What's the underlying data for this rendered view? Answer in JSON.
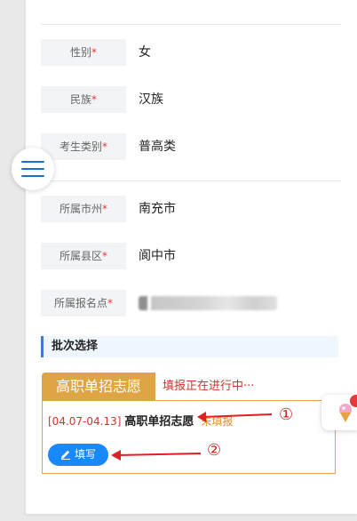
{
  "profile": {
    "fields": [
      {
        "label": "性别",
        "required_mark": "*",
        "value": "女"
      },
      {
        "label": "民族",
        "required_mark": "*",
        "value": "汉族"
      },
      {
        "label": "考生类别",
        "required_mark": "*",
        "value": "普高类"
      },
      {
        "label": "所属市州",
        "required_mark": "*",
        "value": "南充市"
      },
      {
        "label": "所属县区",
        "required_mark": "*",
        "value": "阆中市"
      },
      {
        "label": "所属报名点",
        "required_mark": "*",
        "value": ""
      }
    ]
  },
  "batch": {
    "section_title": "批次选择",
    "tab_label": "高职单招志愿",
    "status_text": "填报正在进行中···",
    "date_range": "[04.07-04.13]",
    "name": "高职单招志愿",
    "tag": "未填报",
    "fill_button_label": "填写"
  },
  "annotations": {
    "marker_1": "①",
    "marker_2": "②",
    "arrow_color": "#e02020"
  },
  "icons": {
    "menu": "hamburger-menu-icon",
    "edit": "pencil-icon",
    "widget": "ice-cream-icon"
  },
  "colors": {
    "accent": "#1989fa",
    "tab": "#dfa443",
    "status": "#d0342c",
    "section_border": "#3a7bd5"
  }
}
